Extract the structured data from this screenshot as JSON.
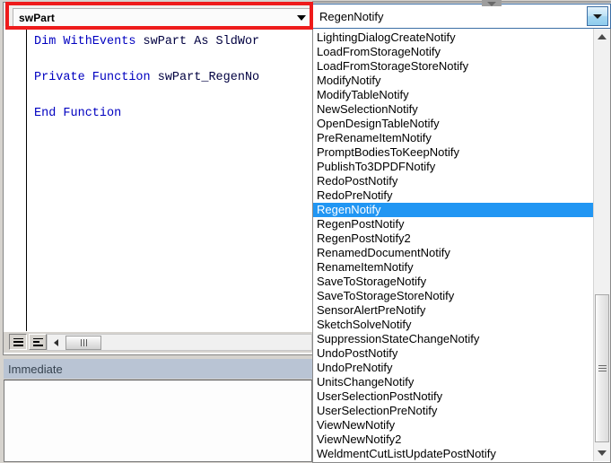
{
  "window": {
    "object_combo": {
      "value": "swPart",
      "arrow_icon": "chevron-down-icon",
      "highlighted": true,
      "highlight_color": "#ee1b1b"
    },
    "procedure_combo": {
      "value": "RegenNotify",
      "arrow_icon": "chevron-down-icon",
      "border_color": "#3c6ea5"
    }
  },
  "code": {
    "lines": [
      {
        "tokens": [
          {
            "t": "Dim WithEvents ",
            "c": "kw"
          },
          {
            "t": "swPart As SldWor",
            "c": "idn"
          }
        ]
      },
      {
        "tokens": [
          {
            "t": "",
            "c": "idn"
          }
        ]
      },
      {
        "tokens": [
          {
            "t": "Private Function ",
            "c": "kw"
          },
          {
            "t": "swPart_RegenNo",
            "c": "idn"
          }
        ]
      },
      {
        "tokens": [
          {
            "t": "",
            "c": "idn"
          }
        ]
      },
      {
        "tokens": [
          {
            "t": "End Function",
            "c": "kw"
          }
        ]
      }
    ]
  },
  "code_toolbar": {
    "procedure_view_button": "procedure-view",
    "full_module_view_button": "full-module-view",
    "hscroll_left_icon": "triangle-left-icon",
    "hscroll_thumb": "horizontal-scroll-thumb"
  },
  "immediate": {
    "title": "Immediate",
    "content": ""
  },
  "dropdown": {
    "selected": "RegenNotify",
    "items": [
      "LightingDialogCreateNotify",
      "LoadFromStorageNotify",
      "LoadFromStorageStoreNotify",
      "ModifyNotify",
      "ModifyTableNotify",
      "NewSelectionNotify",
      "OpenDesignTableNotify",
      "PreRenameItemNotify",
      "PromptBodiesToKeepNotify",
      "PublishTo3DPDFNotify",
      "RedoPostNotify",
      "RedoPreNotify",
      "RegenNotify",
      "RegenPostNotify",
      "RegenPostNotify2",
      "RenamedDocumentNotify",
      "RenameItemNotify",
      "SaveToStorageNotify",
      "SaveToStorageStoreNotify",
      "SensorAlertPreNotify",
      "SketchSolveNotify",
      "SuppressionStateChangeNotify",
      "UndoPostNotify",
      "UndoPreNotify",
      "UnitsChangeNotify",
      "UserSelectionPostNotify",
      "UserSelectionPreNotify",
      "ViewNewNotify",
      "ViewNewNotify2",
      "WeldmentCutListUpdatePostNotify"
    ],
    "scrollbar": {
      "up_icon": "triangle-up-icon",
      "down_icon": "triangle-down-icon",
      "thumb": "vertical-scroll-thumb"
    },
    "selection_color": "#2196f3"
  }
}
